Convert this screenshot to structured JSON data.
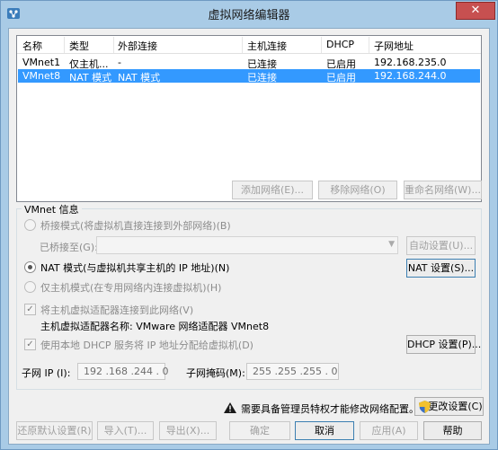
{
  "window": {
    "title": "虚拟网络编辑器",
    "close_symbol": "✕"
  },
  "table": {
    "columns": [
      "名称",
      "类型",
      "外部连接",
      "主机连接",
      "DHCP",
      "子网地址"
    ],
    "rows": [
      {
        "name": "VMnet1",
        "type": "仅主机...",
        "external": "-",
        "host": "已连接",
        "dhcp": "已启用",
        "subnet": "192.168.235.0",
        "selected": false
      },
      {
        "name": "VMnet8",
        "type": "NAT 模式",
        "external": "NAT 模式",
        "host": "已连接",
        "dhcp": "已启用",
        "subnet": "192.168.244.0",
        "selected": true
      }
    ]
  },
  "table_buttons": {
    "add": "添加网络(E)...",
    "remove": "移除网络(O)",
    "rename": "重命名网络(W)..."
  },
  "vmnet_info": {
    "group_label": "VMnet 信息",
    "bridged_label": "桥接模式(将虚拟机直接连接到外部网络)(B)",
    "bridged_to_label": "已桥接至(G):",
    "auto_settings": "自动设置(U)...",
    "nat_label": "NAT 模式(与虚拟机共享主机的 IP 地址)(N)",
    "nat_settings": "NAT 设置(S)...",
    "hostonly_label": "仅主机模式(在专用网络内连接虚拟机)(H)",
    "connect_adapter_label": "将主机虚拟适配器连接到此网络(V)",
    "adapter_name_text": "主机虚拟适配器名称: VMware 网络适配器 VMnet8",
    "dhcp_label": "使用本地 DHCP 服务将 IP 地址分配给虚拟机(D)",
    "dhcp_settings": "DHCP 设置(P)...",
    "subnet_ip_label": "子网 IP (I):",
    "subnet_ip_value": "192 .168 .244 . 0",
    "subnet_mask_label": "子网掩码(M):",
    "subnet_mask_value": "255 .255 .255 . 0"
  },
  "admin": {
    "notice": "需要具备管理员特权才能修改网络配置。",
    "change_settings": "更改设置(C)"
  },
  "footer": {
    "restore": "还原默认设置(R)",
    "import": "导入(T)...",
    "export": "导出(X)...",
    "ok": "确定",
    "cancel": "取消",
    "apply": "应用(A)",
    "help": "帮助"
  },
  "colors": {
    "selection": "#3399ff",
    "titlebar": "#a9cbe6",
    "close": "#c75050"
  }
}
